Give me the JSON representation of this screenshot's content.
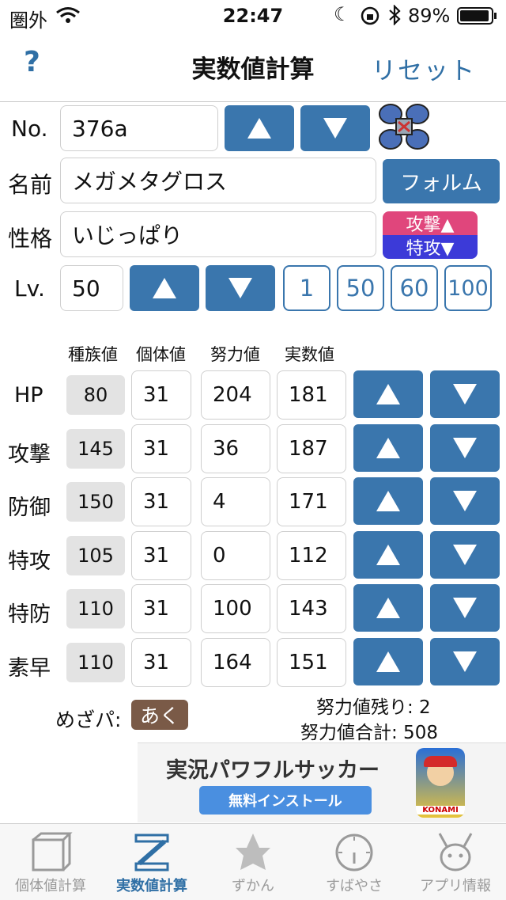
{
  "status": {
    "carrier": "圏外",
    "time": "22:47",
    "battery": "89%"
  },
  "nav": {
    "help": "?",
    "title": "実数値計算",
    "reset": "リセット"
  },
  "form": {
    "no_label": "No.",
    "no_value": "376a",
    "name_label": "名前",
    "name_value": "メガメタグロス",
    "forme_button": "フォルム",
    "nature_label": "性格",
    "nature_value": "いじっぱり",
    "nature_up": "攻撃▲",
    "nature_down": "特攻▼",
    "lv_label": "Lv.",
    "lv_value": "50",
    "lv_presets": [
      "1",
      "50",
      "60",
      "100"
    ]
  },
  "colors": {
    "accent": "#3a76ad",
    "nature_up_bg": "#e0467c",
    "nature_down_bg": "#3c3ad8",
    "base_bg": "#e3e3e3",
    "hidden_power_bg": "#7a5a47"
  },
  "stats_headers": [
    "種族値",
    "個体値",
    "努力値",
    "実数値"
  ],
  "stats": [
    {
      "name": "HP",
      "base": "80",
      "iv": "31",
      "ev": "204",
      "actual": "181"
    },
    {
      "name": "攻撃",
      "base": "145",
      "iv": "31",
      "ev": "36",
      "actual": "187"
    },
    {
      "name": "防御",
      "base": "150",
      "iv": "31",
      "ev": "4",
      "actual": "171"
    },
    {
      "name": "特攻",
      "base": "105",
      "iv": "31",
      "ev": "0",
      "actual": "112"
    },
    {
      "name": "特防",
      "base": "110",
      "iv": "31",
      "ev": "100",
      "actual": "143"
    },
    {
      "name": "素早",
      "base": "110",
      "iv": "31",
      "ev": "164",
      "actual": "151"
    }
  ],
  "summary": {
    "hidden_power_label": "めざパ:",
    "hidden_power_type": "あく",
    "ev_remaining": "努力値残り: 2",
    "ev_total": "努力値合計: 508"
  },
  "ad": {
    "title": "実況パワフルサッカー",
    "install": "無料インストール",
    "brand": "KONAMI"
  },
  "tabs": [
    {
      "label": "個体値計算",
      "icon": "cube-icon",
      "active": false
    },
    {
      "label": "実数値計算",
      "icon": "ruler-z-icon",
      "active": true
    },
    {
      "label": "ずかん",
      "icon": "pokemon-silhouette-icon",
      "active": false
    },
    {
      "label": "すばやさ",
      "icon": "speedometer-icon",
      "active": false
    },
    {
      "label": "アプリ情報",
      "icon": "pikachu-icon",
      "active": false
    }
  ]
}
